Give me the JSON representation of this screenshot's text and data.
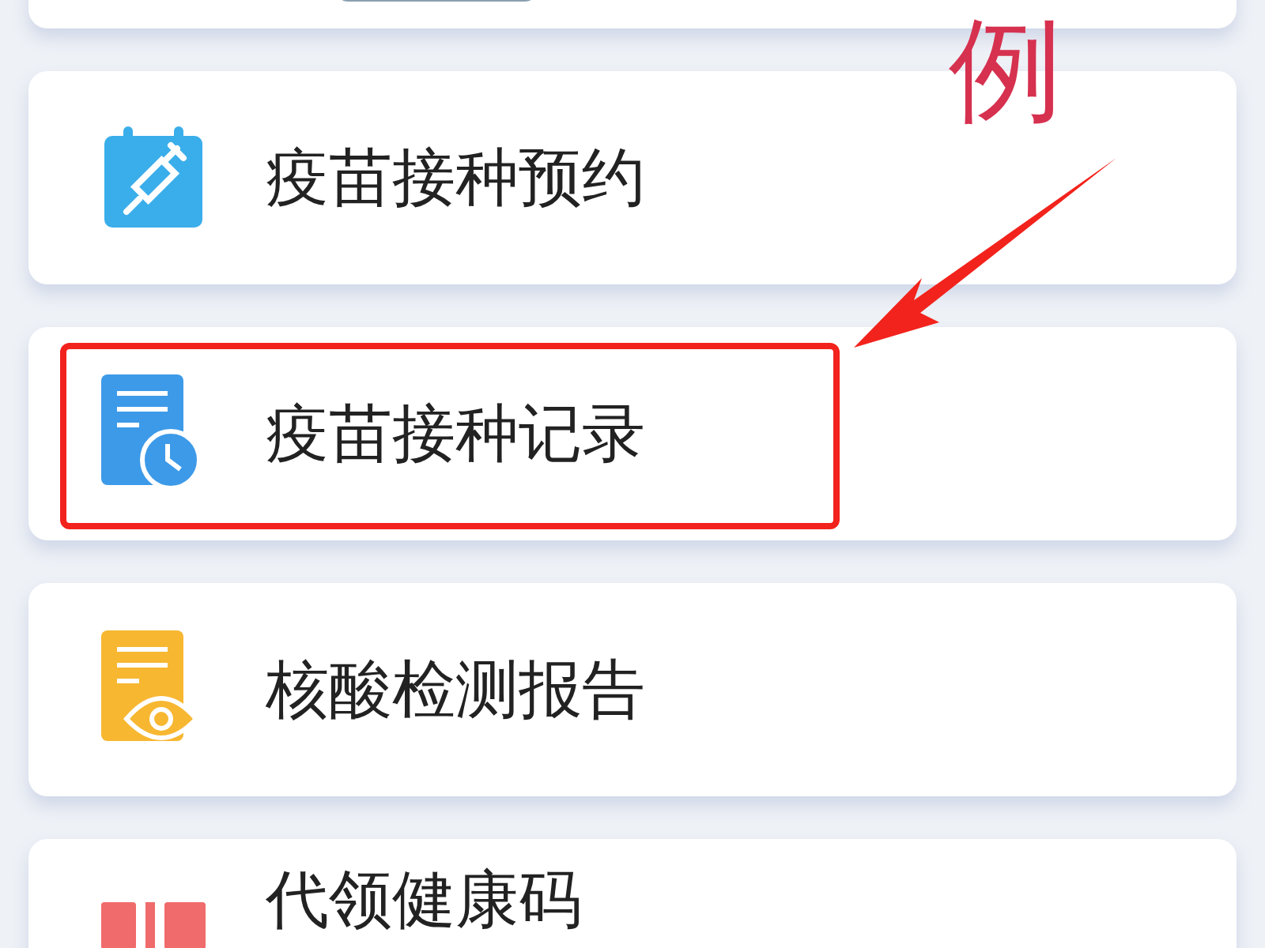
{
  "items": [
    {
      "kind": "partial",
      "highlighted": false
    },
    {
      "kind": "syringe",
      "label": "疫苗接种预约",
      "highlighted": false
    },
    {
      "kind": "clock-doc",
      "label": "疫苗接种记录",
      "highlighted": true
    },
    {
      "kind": "eye-doc",
      "label": "核酸检测报告",
      "highlighted": false
    },
    {
      "kind": "grid",
      "label": "代领健康码",
      "highlighted": false
    }
  ],
  "annotation": {
    "text": "例"
  }
}
